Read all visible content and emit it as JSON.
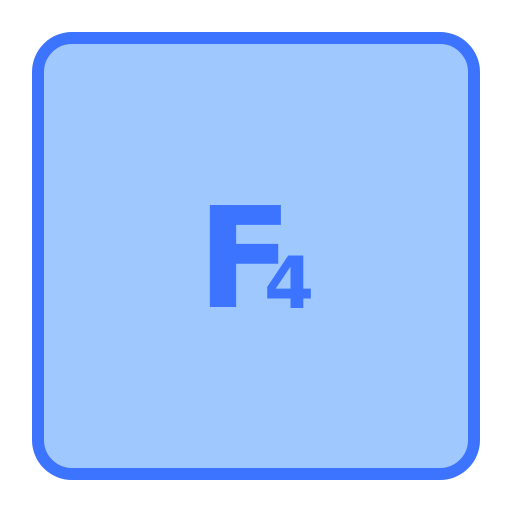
{
  "icon": {
    "name": "f4-key-icon",
    "letter": "F",
    "digit": "4",
    "colors": {
      "fill": "#9fc8ff",
      "stroke": "#3d74ff",
      "text": "#3d74ff",
      "background": "#ffffff"
    }
  }
}
